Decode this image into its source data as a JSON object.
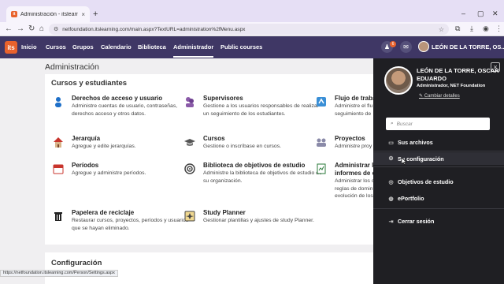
{
  "browser": {
    "tab_title": "Administración - itslearning",
    "url": "netfoundation.itslearning.com/main.aspx?TextURL=administration%2fMenu.aspx",
    "status_url": "https://netfoundation.itslearning.com/Person/Settings.aspx"
  },
  "appnav": {
    "logo": "its",
    "items": [
      "Inicio",
      "Cursos",
      "Grupos",
      "Calendario",
      "Biblioteca",
      "Administrador",
      "Public courses"
    ],
    "notif_count": "6",
    "username": "LEÓN DE LA TORRE, OS..."
  },
  "main": {
    "page_title": "Administración",
    "section1_title": "Cursos y estudiantes",
    "items": [
      {
        "title": "Derechos de acceso y usuario",
        "desc": "Administre cuentas de usuario, contraseñas, derechos acceso y otros datos.",
        "icon": "user-icon"
      },
      {
        "title": "Supervisores",
        "desc": "Gestione a los usuarios responsables de realizar un seguimiento de los estudiantes.",
        "icon": "supervisor-icon"
      },
      {
        "title": "Flujo de traba",
        "desc": "Administre el flu seguimiento de",
        "icon": "workflow-icon"
      },
      {
        "title": "Jerarquía",
        "desc": "Agregue y edite jerarquías.",
        "icon": "hierarchy-icon"
      },
      {
        "title": "Cursos",
        "desc": "Gestione o inscríbase en cursos.",
        "icon": "graduation-cap-icon"
      },
      {
        "title": "Proyectos",
        "desc": "Administre proy",
        "icon": "projects-icon"
      },
      {
        "title": "Períodos",
        "desc": "Agregue y administre períodos.",
        "icon": "calendar-icon"
      },
      {
        "title": "Biblioteca de objetivos de estudio",
        "desc": "Administre la biblioteca de objetivos de estudio de su organización.",
        "icon": "target-icon"
      },
      {
        "title": "Administrar l informes de c",
        "desc": "Administrar los c reglas de domin evolución de los",
        "icon": "report-icon"
      },
      {
        "title": "Papelera de reciclaje",
        "desc": "Restaurar cursos, proyectos, períodos y usuarios que se hayan eliminado.",
        "icon": "trash-icon"
      },
      {
        "title": "Study Planner",
        "desc": "Gestionar plantillas y ajustes de study Planner.",
        "icon": "planner-icon"
      }
    ],
    "section2_title": "Configuración"
  },
  "panel": {
    "name": "LEÓN DE LA TORRE, OSCAR EDUARDO",
    "role": "Administrador, NET Foundation",
    "change_details": "Cambiar detalles",
    "search_placeholder": "Buscar",
    "items": [
      "Sus archivos",
      "Su configuración",
      "Objetivos de estudio",
      "ePortfolio",
      "Cerrar sesión"
    ]
  },
  "colors": {
    "nav_bg": "#3f3765",
    "accent": "#e8622c",
    "panel_bg": "#1f1f23"
  }
}
